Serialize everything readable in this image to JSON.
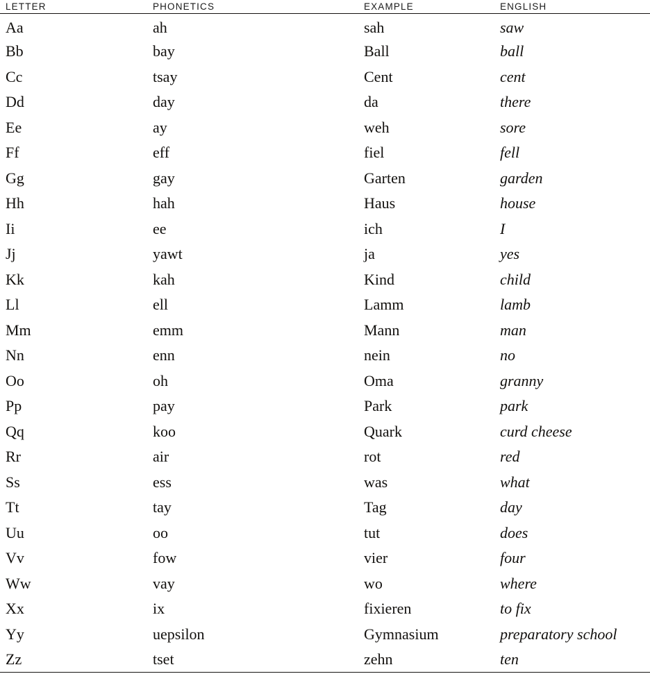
{
  "table": {
    "columns": [
      {
        "key": "letter",
        "label": "LETTER"
      },
      {
        "key": "phonetics",
        "label": "PHONETICS"
      },
      {
        "key": "example",
        "label": "EXAMPLE"
      },
      {
        "key": "english",
        "label": "ENGLISH"
      }
    ],
    "rows": [
      {
        "letter": "Aa",
        "phonetics": "ah",
        "example": "sah",
        "english": "saw"
      },
      {
        "letter": "Bb",
        "phonetics": "bay",
        "example": "Ball",
        "english": "ball"
      },
      {
        "letter": "Cc",
        "phonetics": "tsay",
        "example": "Cent",
        "english": "cent"
      },
      {
        "letter": "Dd",
        "phonetics": "day",
        "example": "da",
        "english": "there"
      },
      {
        "letter": "Ee",
        "phonetics": "ay",
        "example": "weh",
        "english": "sore"
      },
      {
        "letter": "Ff",
        "phonetics": "eff",
        "example": "fiel",
        "english": "fell"
      },
      {
        "letter": "Gg",
        "phonetics": "gay",
        "example": "Garten",
        "english": "garden"
      },
      {
        "letter": "Hh",
        "phonetics": "hah",
        "example": "Haus",
        "english": "house"
      },
      {
        "letter": "Ii",
        "phonetics": "ee",
        "example": "ich",
        "english": "I"
      },
      {
        "letter": "Jj",
        "phonetics": "yawt",
        "example": "ja",
        "english": "yes"
      },
      {
        "letter": "Kk",
        "phonetics": "kah",
        "example": "Kind",
        "english": "child"
      },
      {
        "letter": "Ll",
        "phonetics": "ell",
        "example": "Lamm",
        "english": "lamb"
      },
      {
        "letter": "Mm",
        "phonetics": "emm",
        "example": "Mann",
        "english": "man"
      },
      {
        "letter": "Nn",
        "phonetics": "enn",
        "example": "nein",
        "english": "no"
      },
      {
        "letter": "Oo",
        "phonetics": "oh",
        "example": "Oma",
        "english": "granny"
      },
      {
        "letter": "Pp",
        "phonetics": "pay",
        "example": "Park",
        "english": "park"
      },
      {
        "letter": "Qq",
        "phonetics": "koo",
        "example": "Quark",
        "english": "curd cheese"
      },
      {
        "letter": "Rr",
        "phonetics": "air",
        "example": "rot",
        "english": "red"
      },
      {
        "letter": "Ss",
        "phonetics": "ess",
        "example": "was",
        "english": "what"
      },
      {
        "letter": "Tt",
        "phonetics": "tay",
        "example": "Tag",
        "english": "day"
      },
      {
        "letter": "Uu",
        "phonetics": "oo",
        "example": "tut",
        "english": "does"
      },
      {
        "letter": "Vv",
        "phonetics": "fow",
        "example": "vier",
        "english": "four"
      },
      {
        "letter": "Ww",
        "phonetics": "vay",
        "example": "wo",
        "english": "where"
      },
      {
        "letter": "Xx",
        "phonetics": "ix",
        "example": "fixieren",
        "english": "to fix"
      },
      {
        "letter": "Yy",
        "phonetics": "uepsilon",
        "example": "Gymnasium",
        "english": "preparatory school"
      },
      {
        "letter": "Zz",
        "phonetics": "tset",
        "example": "zehn",
        "english": "ten"
      }
    ]
  },
  "style": {
    "rule_color": "#13110f",
    "text_color": "#12100e",
    "background": "#ffffff"
  }
}
